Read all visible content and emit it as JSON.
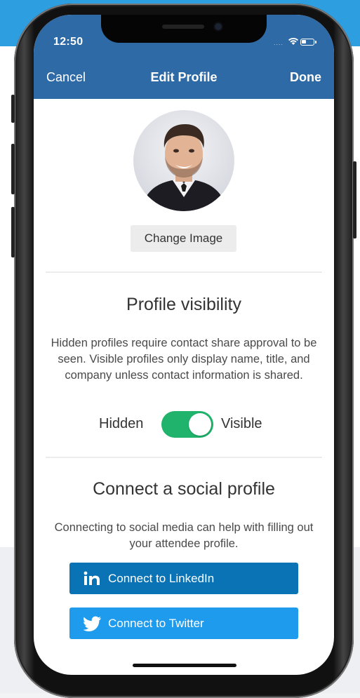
{
  "status": {
    "time": "12:50"
  },
  "nav": {
    "cancel": "Cancel",
    "title": "Edit Profile",
    "done": "Done"
  },
  "profile": {
    "change_image": "Change Image"
  },
  "visibility": {
    "heading": "Profile visibility",
    "description": "Hidden profiles require contact share approval to be seen. Visible profiles only display name, title, and company unless contact information is shared.",
    "hidden_label": "Hidden",
    "visible_label": "Visible",
    "is_visible": true
  },
  "social": {
    "heading": "Connect a social profile",
    "description": "Connecting to social media can help with filling out your attendee profile.",
    "linkedin_label": "Connect to LinkedIn",
    "twitter_label": "Connect to Twitter"
  },
  "colors": {
    "nav_bar": "#2e6aa6",
    "toggle_on": "#1fb36b",
    "linkedin": "#0a73b5",
    "twitter": "#1e9bec",
    "page_header_band": "#2d9fe0"
  },
  "icons": [
    "wifi-icon",
    "battery-icon",
    "linkedin-icon",
    "twitter-icon"
  ]
}
